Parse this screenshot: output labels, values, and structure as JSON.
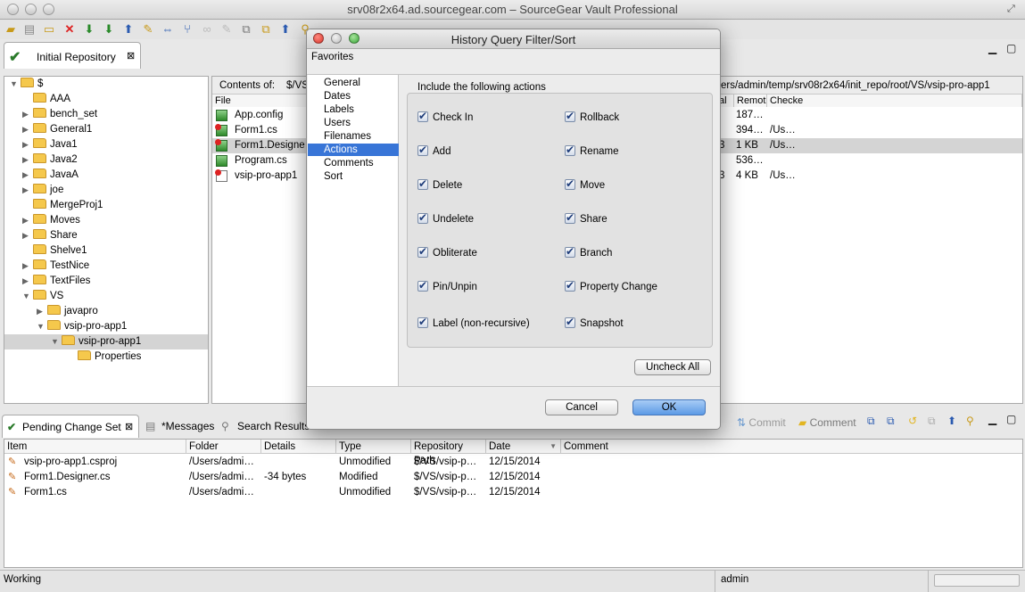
{
  "window": {
    "title": "srv08r2x64.ad.sourcegear.com – SourceGear Vault Professional"
  },
  "repo_tab": {
    "label": "Initial Repository",
    "close": "⊠"
  },
  "tree": {
    "root": "$",
    "items": [
      "AAA",
      "bench_set",
      "General1",
      "Java1",
      "Java2",
      "JavaA",
      "joe",
      "MergeProj1",
      "Moves",
      "Share",
      "Shelve1",
      "TestNice",
      "TextFiles",
      "VS",
      "javapro",
      "vsip-pro-app1",
      "vsip-pro-app1",
      "Properties"
    ]
  },
  "contents": {
    "label": "Contents of:",
    "path_left": "$/VS/",
    "path_right": "ers/admin/temp/srv08r2x64/init_repo/root/VS/vsip-pro-app1",
    "headers": {
      "file": "File",
      "local_size": "al S",
      "remote": "Remot",
      "checked": "Checke"
    },
    "files": [
      {
        "name": "App.config",
        "mid": "",
        "remote": "187…",
        "checked": ""
      },
      {
        "name": "Form1.cs",
        "mid": "",
        "remote": "394…",
        "checked": "/Us…"
      },
      {
        "name": "Form1.Designe",
        "mid": "3",
        "remote": "1 KB",
        "checked": "/Us…"
      },
      {
        "name": "Program.cs",
        "mid": "",
        "remote": "536…",
        "checked": ""
      },
      {
        "name": "vsip-pro-app1",
        "mid": "3",
        "remote": "4 KB",
        "checked": "/Us…"
      }
    ]
  },
  "bottom_tabs": {
    "pending": "Pending Change Set",
    "messages": "*Messages",
    "search": "Search Results",
    "close": "⊠"
  },
  "bottom_toolbar": {
    "commit": "Commit",
    "comment": "Comment"
  },
  "pending": {
    "headers": {
      "item": "Item",
      "folder": "Folder",
      "details": "Details",
      "type": "Type",
      "repo_path": "Repository Path",
      "date": "Date",
      "comment": "Comment"
    },
    "rows": [
      {
        "item": "vsip-pro-app1.csproj",
        "folder": "/Users/admi…",
        "details": "",
        "type": "Unmodified",
        "repo_path": "$/VS/vsip-p…",
        "date": "12/15/2014"
      },
      {
        "item": "Form1.Designer.cs",
        "folder": "/Users/admi…",
        "details": "-34 bytes",
        "type": "Modified",
        "repo_path": "$/VS/vsip-p…",
        "date": "12/15/2014"
      },
      {
        "item": "Form1.cs",
        "folder": "/Users/admi…",
        "details": "",
        "type": "Unmodified",
        "repo_path": "$/VS/vsip-p…",
        "date": "12/15/2014"
      }
    ]
  },
  "status": {
    "left": "Working",
    "user": "admin"
  },
  "dialog": {
    "title": "History Query Filter/Sort",
    "favorites": "Favorites",
    "nav": [
      "General",
      "Dates",
      "Labels",
      "Users",
      "Filenames",
      "Actions",
      "Comments",
      "Sort"
    ],
    "selected_nav": "Actions",
    "group_title": "Include the following actions",
    "actions_left": [
      "Check In",
      "Add",
      "Delete",
      "Undelete",
      "Obliterate",
      "Pin/Unpin",
      "Label (non-recursive)"
    ],
    "actions_right": [
      "Rollback",
      "Rename",
      "Move",
      "Share",
      "Branch",
      "Property Change",
      "Snapshot"
    ],
    "uncheck_all": "Uncheck All",
    "cancel": "Cancel",
    "ok": "OK"
  }
}
